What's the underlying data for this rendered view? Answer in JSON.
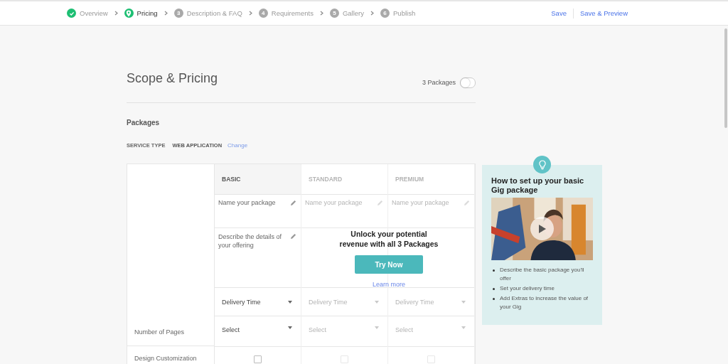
{
  "steps": [
    {
      "label": "Overview",
      "completed": true,
      "selected": false
    },
    {
      "label": "Pricing",
      "completed": false,
      "selected": true
    },
    {
      "number": "3",
      "label": "Description & FAQ",
      "completed": false,
      "selected": false
    },
    {
      "number": "4",
      "label": "Requirements",
      "completed": false,
      "selected": false
    },
    {
      "number": "5",
      "label": "Gallery",
      "completed": false,
      "selected": false
    },
    {
      "number": "6",
      "label": "Publish",
      "completed": false,
      "selected": false
    }
  ],
  "actions": [
    "Save",
    "Save & Preview"
  ],
  "title": "Scope & Pricing",
  "packages_toggle": {
    "label": "3 Packages",
    "on": false
  },
  "section_title": "Packages",
  "service_type": {
    "label": "SERVICE TYPE",
    "value": "WEB APPLICATION",
    "link": "Change"
  },
  "packages": [
    {
      "name": "BASIC",
      "active": true,
      "name_placeholder": "Name your package",
      "description_placeholder": "Describe the details of your offering",
      "delivery": "Delivery Time",
      "pages": "Select",
      "design_checked": false
    },
    {
      "name": "STANDARD",
      "active": false,
      "name_placeholder": "Name your package",
      "delivery": "Delivery Time",
      "pages": "Select",
      "design_checked": false
    },
    {
      "name": "PREMIUM",
      "active": false,
      "name_placeholder": "Name your package",
      "delivery": "Delivery Time",
      "pages": "Select",
      "design_checked": false
    }
  ],
  "row_labels": {
    "pages": "Number of Pages",
    "design": "Design Customization"
  },
  "upsell": {
    "message": "Unlock your potential revenue with all 3 Packages",
    "button": "Try Now",
    "link": "Learn more"
  },
  "tip": {
    "title": "How to set up your basic Gig package",
    "bullets": [
      "Describe the basic package you'll offer",
      "Set your delivery time",
      "Add Extras to increase the value of your Gig"
    ]
  }
}
